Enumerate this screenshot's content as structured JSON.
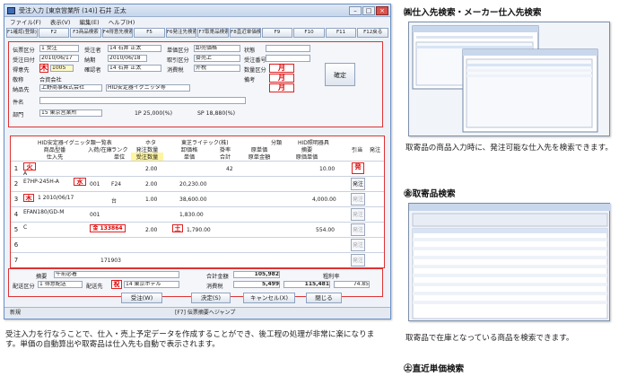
{
  "window": {
    "title": "受注入力 [東京営業所 (14)] 石井 正太",
    "menu": [
      "ファイル(F)",
      "表示(V)",
      "編集(E)",
      "ヘルプ(H)"
    ],
    "fkeys": [
      "F1確認(登録)",
      "F2",
      "F3商品検索",
      "F4得意先検索",
      "F5",
      "F6発注先検索",
      "F7取寄品検索",
      "F8直近単価検索",
      "F9",
      "F10",
      "F11",
      "F12戻る"
    ]
  },
  "header": {
    "labels": {
      "denpyo_kubun": "伝票区分",
      "juchu_date": "受注日付",
      "tokui": "得意先",
      "nohin": "納品先",
      "kenmei": "件名",
      "tantou": "受注者",
      "tanka": "単価区分",
      "juchu_no": "受注番号",
      "nouki": "納期",
      "kakuninsha": "確認者",
      "torihiki": "取引区分",
      "zei": "消費税",
      "suuryou": "数量区分",
      "status": "状態",
      "bikou": "備考",
      "keisen": "敬称",
      "bumon": "部門"
    },
    "values": {
      "denpyo_kubun": "1 受注",
      "juchu_date": "2010/06/17",
      "juchu_no": "2010/06/18",
      "tantou": "14 石井 正太",
      "kakuninsha": "14 石井 正太",
      "tanka": "卸売価格",
      "torihiki": "掛売上",
      "zei": "外税",
      "tokui_code": "1005",
      "tokui_name": "合資会社",
      "nohin_name": "上野商事株式会社",
      "kenmei_value": "HID安定器イグニッタ等",
      "bumon_value": "15 東京営業所",
      "limit": "1P 25,000(%)",
      "sp": "SP 18,880(%)"
    },
    "red_tags": [
      "木",
      "月",
      "月",
      "月"
    ],
    "decide_button": "確定"
  },
  "grid": {
    "headers": [
      "商品型番",
      "入荷/在庫",
      "ランク",
      "単位",
      "発注数量",
      "受注数量",
      "卸価格",
      "単価",
      "掛率",
      "合計",
      "原単価",
      "原単金額",
      "摘要",
      "原価単価",
      "引当",
      "発注"
    ],
    "subheaders": [
      "仕入先",
      "メーカー",
      "商品名",
      "メーカー品番"
    ],
    "top_info": [
      "HID安定器イグニッタ類一覧表",
      "ホタ",
      "東芝ライテック(株)",
      "分類",
      "HID照明器具"
    ],
    "rows": [
      {
        "n": "1",
        "code": "火",
        "item": "A",
        "stock": "",
        "unit": "",
        "order_qty": "2.00",
        "juchu_qty": "",
        "price": "",
        "rate": "42",
        "amount": "",
        "cost": "10.00",
        "tags": [
          "火",
          "発"
        ]
      },
      {
        "n": "2",
        "code": "水",
        "item": "E7HP-245H-A",
        "stock": "001",
        "unit": "F24",
        "order_qty": "2.00",
        "juchu_qty": "",
        "price": "20,230.00",
        "rate": "",
        "amount": "",
        "cost": "",
        "tags": [
          "水"
        ]
      },
      {
        "n": "3",
        "code": "木",
        "item": "1 2010/06/17",
        "stock": "",
        "unit": "台",
        "order_qty": "1.00",
        "juchu_qty": "",
        "price": "38,600.00",
        "rate": "",
        "amount": "",
        "cost": "4,000.00",
        "tags": [
          "木"
        ]
      },
      {
        "n": "4",
        "code": "",
        "item": "EFAN180/GD-M",
        "stock": "001",
        "unit": "",
        "order_qty": "",
        "juchu_qty": "",
        "price": "1,830.00",
        "rate": "",
        "amount": "",
        "cost": "",
        "tags": []
      },
      {
        "n": "5",
        "code": "金",
        "item": "C",
        "stock": "金 133864",
        "unit": "",
        "order_qty": "2.00",
        "juchu_qty": "",
        "price": "1,790.00",
        "rate": "土",
        "amount": "",
        "cost": "554.00",
        "tags": [
          "金",
          "土"
        ]
      },
      {
        "n": "6",
        "code": "",
        "item": "",
        "stock": "",
        "unit": "",
        "order_qty": "",
        "juchu_qty": "",
        "price": "",
        "rate": "",
        "amount": "",
        "cost": "",
        "tags": []
      },
      {
        "n": "7",
        "code": "",
        "item": "",
        "stock": "171903",
        "unit": "",
        "order_qty": "",
        "juchu_qty": "",
        "price": "",
        "rate": "",
        "amount": "",
        "cost": "",
        "tags": []
      }
    ],
    "side_buttons": [
      "発注",
      "発注",
      "発注",
      "発注",
      "発注",
      "発注",
      "発注"
    ]
  },
  "footer": {
    "bikou_label": "摘要",
    "bikou_value": "午前必着",
    "haisou_label": "配送区分",
    "haisou_value": "1 得意配送",
    "haisousaki_label": "配送先",
    "haisousaki_tag": "祝",
    "haisousaki_value": "14 東京ホテル",
    "gokei_label": "合計金額",
    "gokei_value": "105,982",
    "zei_label": "消費税",
    "zei_value": "5,499",
    "total_value": "115,481",
    "rieki_label": "粗利率",
    "rieki_value": "74.85",
    "buttons": [
      "受注(W)",
      "決定(S)",
      "キャンセル(X)",
      "閉じる"
    ],
    "status_left": "新規",
    "status_right": "[F7] 伝票摘要へジャンプ"
  },
  "right": {
    "sec1_title": "㈱仕入先検索・メーカー仕入先検索",
    "sec1_caption": "取寄品の商品入力時に、発注可能な仕入先を検索できます。",
    "sec2_title": "㊎取寄品検索",
    "sec2_caption": "取寄品で在庫となっている商品を検索できます。",
    "sec3_title": "㊏直近単価検索"
  },
  "bottom_caption": "受注入力を行なうことで、仕入・売上予定データを作成することができ、後工程の処理が非常に楽になります。単価の自動算出や取寄品は仕入先も自動で表示されます。"
}
